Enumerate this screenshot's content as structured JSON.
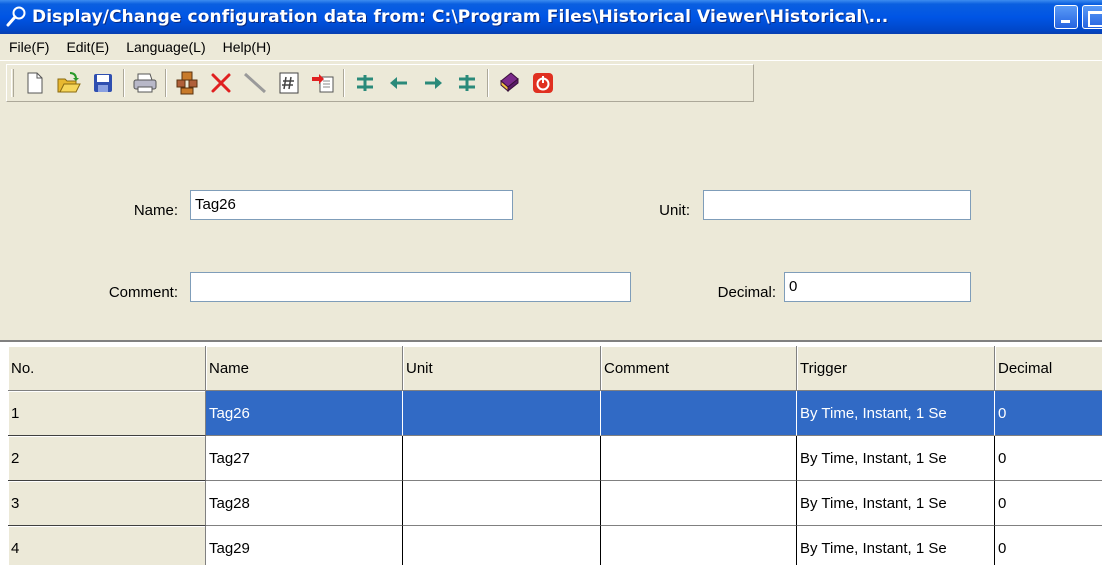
{
  "window": {
    "title": "Display/Change configuration data from: C:\\Program Files\\Historical Viewer\\Historical\\..."
  },
  "menu": {
    "items": [
      {
        "label": "File(F)"
      },
      {
        "label": "Edit(E)"
      },
      {
        "label": "Language(L)"
      },
      {
        "label": "Help(H)"
      }
    ]
  },
  "toolbar": {
    "icons": [
      "new-file-icon",
      "open-folder-icon",
      "save-disk-icon",
      "print-icon",
      "tags-icon",
      "delete-x-icon",
      "line-icon",
      "number-grid-icon",
      "import-icon",
      "move-top-icon",
      "move-left-icon",
      "move-right-icon",
      "move-bottom-icon",
      "book-icon",
      "power-stop-icon"
    ]
  },
  "form": {
    "name_label": "Name:",
    "name_value": "Tag26",
    "unit_label": "Unit:",
    "unit_value": "",
    "comment_label": "Comment:",
    "comment_value": "",
    "decimal_label": "Decimal:",
    "decimal_value": "0"
  },
  "table": {
    "columns": [
      "No.",
      "Name",
      "Unit",
      "Comment",
      "Trigger",
      "Decimal"
    ],
    "rows": [
      {
        "no": "1",
        "name": "Tag26",
        "unit": "",
        "comment": "",
        "trigger": "By Time, Instant, 1 Se",
        "decimal": "0",
        "selected": true
      },
      {
        "no": "2",
        "name": "Tag27",
        "unit": "",
        "comment": "",
        "trigger": "By Time, Instant, 1 Se",
        "decimal": "0",
        "selected": false
      },
      {
        "no": "3",
        "name": "Tag28",
        "unit": "",
        "comment": "",
        "trigger": "By Time, Instant, 1 Se",
        "decimal": "0",
        "selected": false
      },
      {
        "no": "4",
        "name": "Tag29",
        "unit": "",
        "comment": "",
        "trigger": "By Time, Instant, 1 Se",
        "decimal": "0",
        "selected": false
      }
    ]
  },
  "colors": {
    "selection": "#316ac5",
    "titlebar": "#0055e5",
    "face": "#ece9d8"
  }
}
